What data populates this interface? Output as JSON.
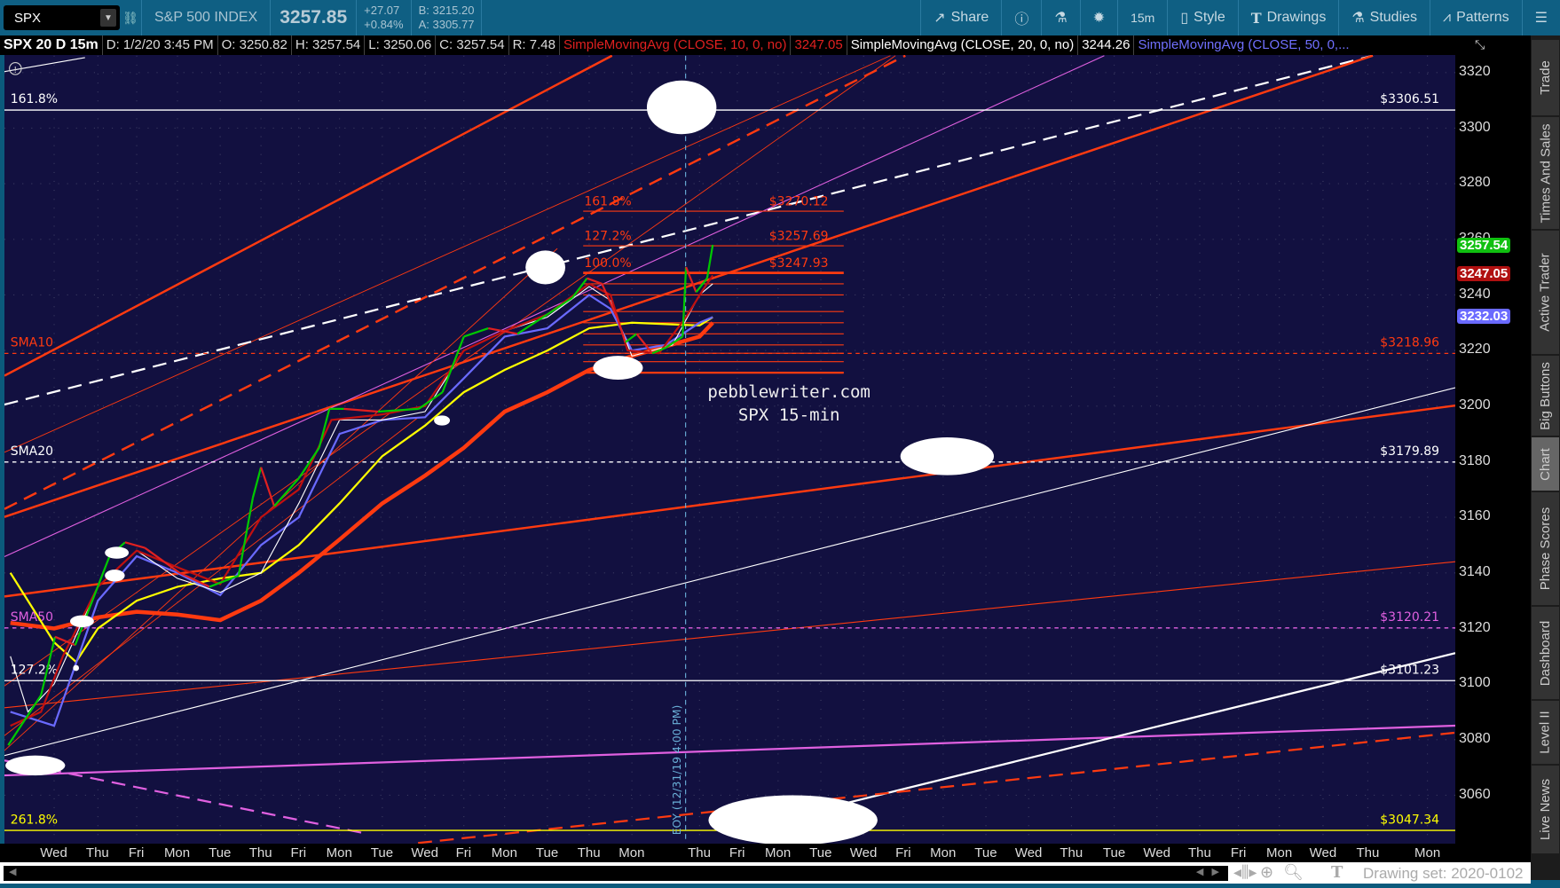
{
  "toolbar": {
    "symbol": "SPX",
    "name": "S&P 500 INDEX",
    "last": "3257.85",
    "change": "+27.07",
    "change_pct": "+0.84%",
    "bid": "B: 3215.20",
    "ask": "A: 3305.77",
    "buttons": [
      {
        "icon": "share-icon",
        "label": "Share"
      },
      {
        "icon": "info-icon",
        "label": ""
      },
      {
        "icon": "flask-icon",
        "label": ""
      },
      {
        "icon": "gear-icon",
        "label": ""
      },
      {
        "icon": "",
        "label": "15m"
      },
      {
        "icon": "candle-icon",
        "label": "Style"
      },
      {
        "icon": "T-icon",
        "label": "Drawings"
      },
      {
        "icon": "flask-icon",
        "label": "Studies"
      },
      {
        "icon": "pattern-icon",
        "label": "Patterns"
      },
      {
        "icon": "menu-icon",
        "label": ""
      }
    ]
  },
  "infobar": {
    "title": "SPX 20 D 15m",
    "date": "D: 1/2/20 3:45 PM",
    "open": "O: 3250.82",
    "high": "H: 3257.54",
    "low": "L: 3250.06",
    "close": "C: 3257.54",
    "range": "R: 7.48",
    "sma10_label": "SimpleMovingAvg (CLOSE, 10, 0, no)",
    "sma10_value": "3247.05",
    "sma20_label": "SimpleMovingAvg (CLOSE, 20, 0, no)",
    "sma20_value": "3244.26",
    "sma50_label": "SimpleMovingAvg (CLOSE, 50, 0,..."
  },
  "colors": {
    "price_up": "#00c800",
    "price_down": "#e02020",
    "sma10": "#c01010",
    "sma20": "#ffffff",
    "sma50": "#6a6aff",
    "yellow": "#ffff00",
    "orange": "#ff3a10",
    "magenta": "#e060e0",
    "background": "#121040"
  },
  "price_axis": {
    "ticks": [
      3320,
      3300,
      3280,
      3260,
      3240,
      3220,
      3200,
      3180,
      3160,
      3140,
      3120,
      3100,
      3080,
      3060
    ],
    "badges": [
      {
        "value": "3257.54",
        "price": 3257.54,
        "color": "#10c010"
      },
      {
        "value": "3247.05",
        "price": 3247.05,
        "color": "#b01010"
      },
      {
        "value": "3232.03",
        "price": 3232.03,
        "color": "#6a6aff"
      }
    ]
  },
  "time_axis": [
    "Wed",
    "Thu",
    "Fri",
    "Mon",
    "Tue",
    "Thu",
    "Fri",
    "Mon",
    "Tue",
    "Wed",
    "Fri",
    "Mon",
    "Tue",
    "Thu",
    "Mon",
    "Thu",
    "Fri",
    "Mon",
    "Tue",
    "Wed",
    "Fri",
    "Mon",
    "Tue",
    "Wed",
    "Thu",
    "Tue",
    "Wed",
    "Thu",
    "Fri",
    "Mon",
    "Wed",
    "Thu",
    "Mon"
  ],
  "levels": [
    {
      "left": "161.8%",
      "right": "$3306.51",
      "price": 3306.51,
      "color": "#ffffff",
      "dash": false
    },
    {
      "left": "SMA10",
      "right": "$3218.96",
      "price": 3218.96,
      "color": "#ff3a10",
      "dash": true
    },
    {
      "left": "SMA20",
      "right": "$3179.89",
      "price": 3179.89,
      "color": "#ffffff",
      "dash": true
    },
    {
      "left": "SMA50",
      "right": "$3120.21",
      "price": 3120.21,
      "color": "#e060e0",
      "dash": true
    },
    {
      "left": "127.2%",
      "right": "$3101.23",
      "price": 3101.23,
      "color": "#ffffff",
      "dash": false
    },
    {
      "left": "261.8%",
      "right": "$3047.34",
      "price": 3047.34,
      "color": "#ffff00",
      "dash": false
    }
  ],
  "fib": [
    {
      "pct": "161.8%",
      "value": "$3270.12",
      "price": 3270.12
    },
    {
      "pct": "127.2%",
      "value": "$3257.69",
      "price": 3257.69
    },
    {
      "pct": "100.0%",
      "value": "$3247.93",
      "price": 3247.93
    }
  ],
  "fib_minor_levels": [
    3244,
    3240,
    3234,
    3230,
    3226,
    3222,
    3219,
    3216,
    3212
  ],
  "watermark": {
    "line1": "pebblewriter.com",
    "line2": "SPX 15-min"
  },
  "eoy_label": "EOY (12/31/19 4:00 PM)",
  "chart_data": {
    "type": "line",
    "x_unit": "time-axis tick index",
    "y_unit": "price",
    "series": [
      {
        "name": "SPX price",
        "points": [
          [
            -1.05,
            3078
          ],
          [
            -0.3,
            3096
          ],
          [
            0.02,
            3117
          ],
          [
            0.48,
            3114
          ],
          [
            1.3,
            3146
          ],
          [
            1.7,
            3151
          ],
          [
            2.2,
            3149
          ],
          [
            3.05,
            3140
          ],
          [
            3.75,
            3135
          ],
          [
            4.45,
            3139
          ],
          [
            4.8,
            3167
          ],
          [
            5.0,
            3178
          ],
          [
            5.35,
            3164
          ],
          [
            6.0,
            3174
          ],
          [
            6.5,
            3185
          ],
          [
            6.75,
            3199
          ],
          [
            7.1,
            3199
          ],
          [
            7.9,
            3198
          ],
          [
            8.85,
            3199
          ],
          [
            9.45,
            3205
          ],
          [
            10.0,
            3225
          ],
          [
            10.6,
            3228
          ],
          [
            11.3,
            3226
          ],
          [
            12.0,
            3233
          ],
          [
            12.6,
            3239
          ],
          [
            12.95,
            3246
          ],
          [
            13.3,
            3244
          ],
          [
            13.65,
            3232
          ],
          [
            13.85,
            3223
          ],
          [
            14.07,
            3226
          ],
          [
            14.3,
            3219
          ],
          [
            14.5,
            3221
          ],
          [
            14.75,
            3225
          ],
          [
            14.8,
            3250
          ],
          [
            14.95,
            3241
          ],
          [
            15.2,
            3246
          ],
          [
            15.35,
            3258
          ]
        ]
      },
      {
        "name": "SMA10",
        "color": "#c01010",
        "points": [
          [
            -1,
            3085
          ],
          [
            -0.3,
            3090
          ],
          [
            0.2,
            3110
          ],
          [
            1,
            3135
          ],
          [
            2,
            3148
          ],
          [
            3,
            3142
          ],
          [
            4,
            3136
          ],
          [
            5,
            3160
          ],
          [
            6,
            3170
          ],
          [
            6.8,
            3195
          ],
          [
            8,
            3197
          ],
          [
            9,
            3200
          ],
          [
            10,
            3220
          ],
          [
            11,
            3227
          ],
          [
            12,
            3233
          ],
          [
            13,
            3244
          ],
          [
            13.5,
            3240
          ],
          [
            13.9,
            3220
          ],
          [
            14.4,
            3219
          ],
          [
            14.8,
            3232
          ],
          [
            15.1,
            3242
          ],
          [
            15.35,
            3247
          ]
        ]
      },
      {
        "name": "SMA20",
        "color": "#ffffff",
        "points": [
          [
            -1,
            3110
          ],
          [
            -0.6,
            3090
          ],
          [
            0,
            3100
          ],
          [
            1,
            3135
          ],
          [
            2,
            3148
          ],
          [
            3,
            3138
          ],
          [
            4,
            3133
          ],
          [
            5,
            3140
          ],
          [
            6,
            3165
          ],
          [
            7,
            3195
          ],
          [
            8,
            3195
          ],
          [
            9,
            3198
          ],
          [
            10,
            3220
          ],
          [
            11,
            3227
          ],
          [
            12,
            3232
          ],
          [
            13,
            3243
          ],
          [
            13.5,
            3238
          ],
          [
            14,
            3218
          ],
          [
            14.6,
            3222
          ],
          [
            15,
            3240
          ],
          [
            15.35,
            3244
          ]
        ]
      },
      {
        "name": "SMA50",
        "color": "#6a6aff",
        "points": [
          [
            -1,
            3090
          ],
          [
            0,
            3085
          ],
          [
            1,
            3130
          ],
          [
            2,
            3146
          ],
          [
            3,
            3140
          ],
          [
            4,
            3132
          ],
          [
            5,
            3150
          ],
          [
            6,
            3160
          ],
          [
            7,
            3190
          ],
          [
            8,
            3195
          ],
          [
            9,
            3196
          ],
          [
            10,
            3210
          ],
          [
            11,
            3225
          ],
          [
            12,
            3228
          ],
          [
            13,
            3240
          ],
          [
            13.5,
            3235
          ],
          [
            14,
            3220
          ],
          [
            14.5,
            3222
          ],
          [
            15,
            3230
          ],
          [
            15.35,
            3232
          ]
        ]
      },
      {
        "name": "SMA100",
        "color": "#ffff00",
        "points": [
          [
            -1,
            3140
          ],
          [
            0,
            3115
          ],
          [
            0.5,
            3108
          ],
          [
            1,
            3120
          ],
          [
            2,
            3130
          ],
          [
            3,
            3135
          ],
          [
            4,
            3138
          ],
          [
            5,
            3140
          ],
          [
            6,
            3150
          ],
          [
            7,
            3165
          ],
          [
            8,
            3182
          ],
          [
            9,
            3193
          ],
          [
            10,
            3205
          ],
          [
            11,
            3213
          ],
          [
            12,
            3220
          ],
          [
            13,
            3228
          ],
          [
            14,
            3230
          ],
          [
            15,
            3229
          ],
          [
            15.35,
            3232
          ]
        ]
      },
      {
        "name": "SMA200",
        "color": "#ff3a10",
        "points": [
          [
            -1,
            3122
          ],
          [
            0,
            3120
          ],
          [
            1,
            3124
          ],
          [
            2,
            3126
          ],
          [
            3,
            3125
          ],
          [
            4,
            3123
          ],
          [
            5,
            3130
          ],
          [
            6,
            3140
          ],
          [
            7,
            3152
          ],
          [
            8,
            3165
          ],
          [
            9,
            3175
          ],
          [
            10,
            3185
          ],
          [
            11,
            3198
          ],
          [
            12,
            3205
          ],
          [
            13,
            3213
          ],
          [
            14,
            3218
          ],
          [
            15,
            3225
          ],
          [
            15.35,
            3230
          ]
        ]
      }
    ],
    "ylim": [
      3042,
      3326
    ]
  },
  "right_tabs": [
    "Trade",
    "Times And Sales",
    "Active Trader",
    "Big Buttons",
    "Chart",
    "Phase Scores",
    "Dashboard",
    "Level II",
    "Live News"
  ],
  "bottom": {
    "drawing_set": "Drawing set: 2020-0102"
  }
}
